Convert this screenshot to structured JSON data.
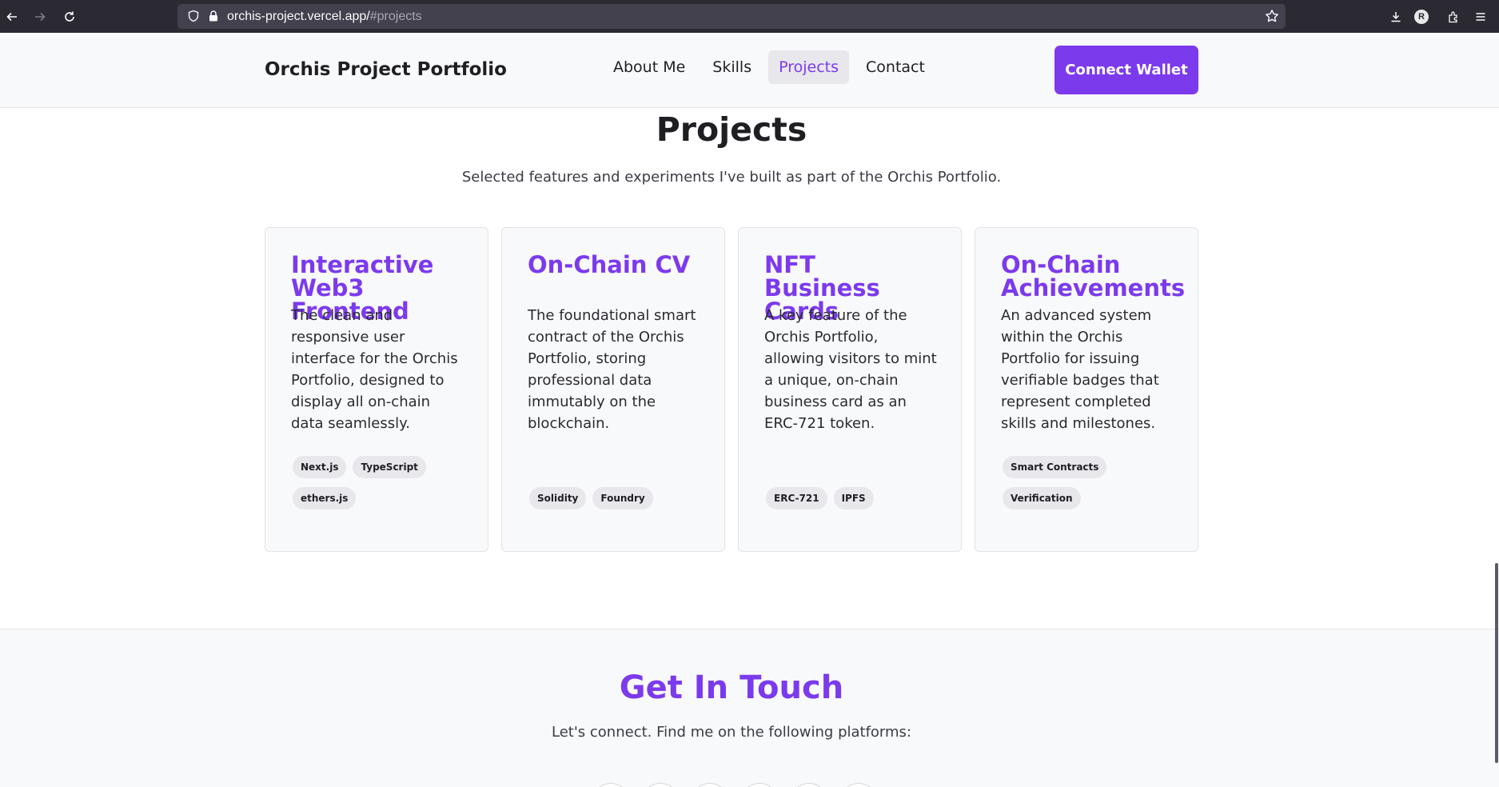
{
  "browser": {
    "url_host": "orchis-project.vercel.app/",
    "url_path": "#projects",
    "profile_initial": "R",
    "icons": [
      "back-icon",
      "forward-icon",
      "reload-icon",
      "shield-icon",
      "lock-icon",
      "star-icon",
      "download-icon",
      "extensions-icon",
      "menu-icon"
    ]
  },
  "header": {
    "title": "Orchis Project Portfolio",
    "nav": [
      {
        "label": "About Me"
      },
      {
        "label": "Skills"
      },
      {
        "label": "Projects",
        "active": true
      },
      {
        "label": "Contact"
      }
    ],
    "connect_label": "Connect Wallet"
  },
  "projects": {
    "title": "Projects",
    "subtitle": "Selected features and experiments I've built as part of the Orchis Portfolio.",
    "cards": [
      {
        "title": "Interactive Web3 Frontend",
        "description": "The clean and responsive user interface for the Orchis Portfolio, designed to display all on-chain data seamlessly.",
        "tags": [
          "Next.js",
          "TypeScript",
          "ethers.js"
        ]
      },
      {
        "title": "On-Chain CV",
        "description": "The foundational smart contract of the Orchis Portfolio, storing professional data immutably on the blockchain.",
        "tags": [
          "Solidity",
          "Foundry"
        ]
      },
      {
        "title": "NFT Business Cards",
        "description": "A key feature of the Orchis Portfolio, allowing visitors to mint a unique, on-chain business card as an ERC-721 token.",
        "tags": [
          "ERC-721",
          "IPFS"
        ]
      },
      {
        "title": "On-Chain Achievements",
        "description": "An advanced system within the Orchis Portfolio for issuing verifiable badges that represent completed skills and milestones.",
        "tags": [
          "Smart Contracts",
          "Verification"
        ]
      }
    ]
  },
  "contact": {
    "title": "Get In Touch",
    "subtitle": "Let's connect. Find me on the following platforms:"
  },
  "colors": {
    "accent": "#7c3aed",
    "header_bg": "#f8f9fa",
    "browser_bg": "#2b2a33"
  }
}
